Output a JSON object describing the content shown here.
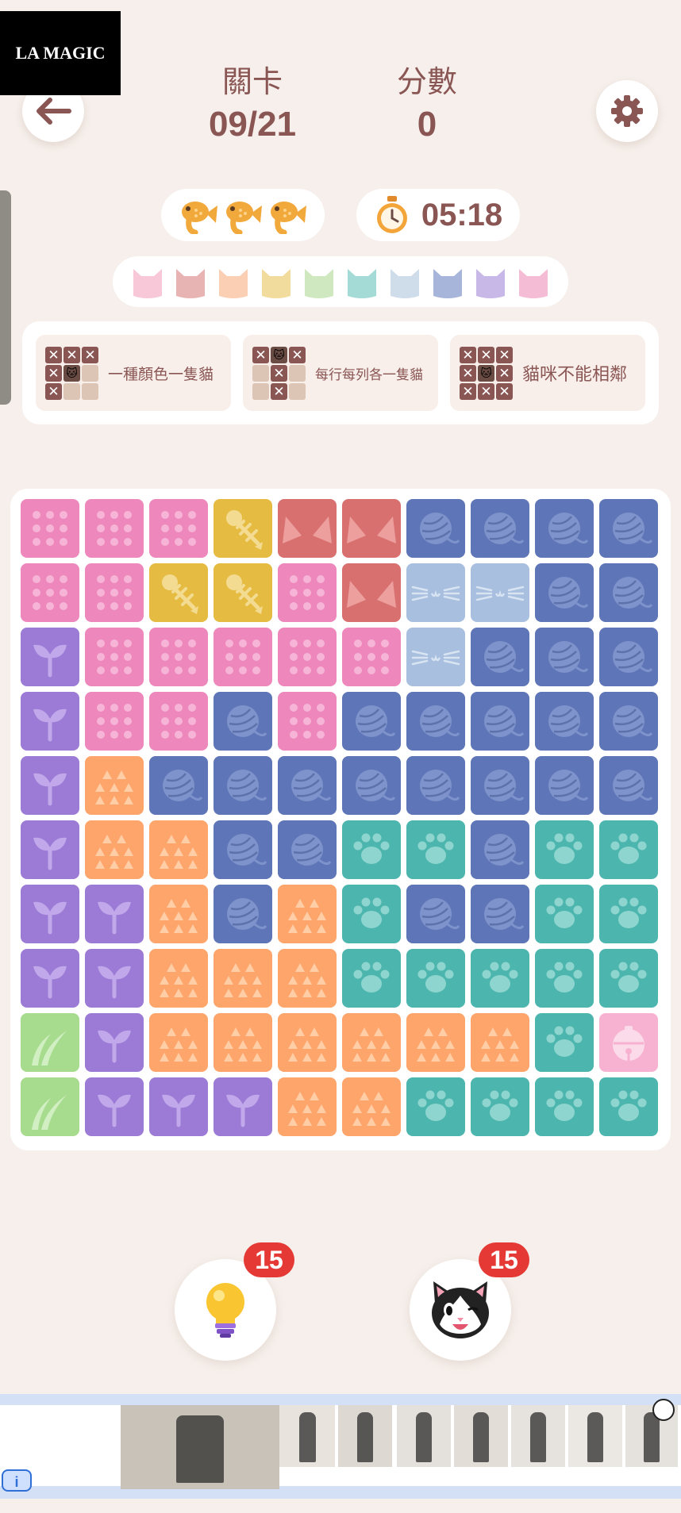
{
  "header": {
    "level_label": "關卡",
    "level_value": "09/21",
    "score_label": "分數",
    "score_value": "0",
    "back_icon": "arrow-left-icon",
    "settings_icon": "gear-icon"
  },
  "status": {
    "lives_icon": "fish-cookie-icon",
    "lives_count": 3,
    "timer_icon": "stopwatch-icon",
    "timer": "05:18"
  },
  "cat_palette": [
    "#f8c8d8",
    "#e8b3b3",
    "#fbcfb4",
    "#f2dc9d",
    "#cfe8c0",
    "#a5dbd6",
    "#cfdcea",
    "#a8b5da",
    "#c8b8e8",
    "#f5bcd6"
  ],
  "rules": [
    {
      "text": "一種顏色一隻貓",
      "mini": [
        "x",
        "x",
        "x",
        "x",
        "k",
        "s",
        "x",
        "s",
        "s"
      ]
    },
    {
      "text": "每行每列各一隻貓",
      "mini": [
        "x",
        "k",
        "x",
        "s",
        "x",
        "s",
        "s",
        "x",
        "s"
      ]
    },
    {
      "text": "貓咪不能相鄰",
      "mini": [
        "x",
        "x",
        "x",
        "x",
        "k",
        "x",
        "x",
        "x",
        "x"
      ]
    }
  ],
  "colors": {
    "P": {
      "bg": "#ee87bb",
      "pattern": "dots",
      "fg": "#f6b5d6"
    },
    "Y": {
      "bg": "#e5bb42",
      "pattern": "fishbone",
      "fg": "#f3db92"
    },
    "R": {
      "bg": "#d97070",
      "pattern": "ears",
      "fg": "#ec9f9c"
    },
    "B": {
      "bg": "#5e76b8",
      "pattern": "yarn",
      "fg": "#7e93cb"
    },
    "L": {
      "bg": "#a8bfdf",
      "pattern": "whiskers",
      "fg": "#d9e4f2"
    },
    "V": {
      "bg": "#9b7bd5",
      "pattern": "sprout",
      "fg": "#c0a8ea"
    },
    "O": {
      "bg": "#fea56c",
      "pattern": "triangles",
      "fg": "#ffcda6"
    },
    "T": {
      "bg": "#4cb6ae",
      "pattern": "paw",
      "fg": "#8fd5cf"
    },
    "G": {
      "bg": "#a7dc8e",
      "pattern": "grass",
      "fg": "#d1efc2"
    },
    "K": {
      "bg": "#f7b1d1",
      "pattern": "bell",
      "fg": "#fbdbe9"
    }
  },
  "board": [
    [
      "P",
      "P",
      "P",
      "Y",
      "R",
      "R",
      "B",
      "B",
      "B",
      "B"
    ],
    [
      "P",
      "P",
      "Y",
      "Y",
      "P",
      "R",
      "L",
      "L",
      "B",
      "B"
    ],
    [
      "V",
      "P",
      "P",
      "P",
      "P",
      "P",
      "L",
      "B",
      "B",
      "B"
    ],
    [
      "V",
      "P",
      "P",
      "B",
      "P",
      "B",
      "B",
      "B",
      "B",
      "B"
    ],
    [
      "V",
      "O",
      "B",
      "B",
      "B",
      "B",
      "B",
      "B",
      "B",
      "B"
    ],
    [
      "V",
      "O",
      "O",
      "B",
      "B",
      "T",
      "T",
      "B",
      "T",
      "T"
    ],
    [
      "V",
      "V",
      "O",
      "B",
      "O",
      "T",
      "B",
      "B",
      "T",
      "T"
    ],
    [
      "V",
      "V",
      "O",
      "O",
      "O",
      "T",
      "T",
      "T",
      "T",
      "T"
    ],
    [
      "G",
      "V",
      "O",
      "O",
      "O",
      "O",
      "O",
      "O",
      "T",
      "K"
    ],
    [
      "G",
      "V",
      "V",
      "V",
      "O",
      "O",
      "T",
      "T",
      "T",
      "T"
    ]
  ],
  "helpers": {
    "hint_icon": "lightbulb-icon",
    "hint_count": "15",
    "cat_icon": "cat-face-icon",
    "cat_count": "15"
  },
  "ad": {
    "brand": "LA MAGIC",
    "info_label": "i"
  }
}
